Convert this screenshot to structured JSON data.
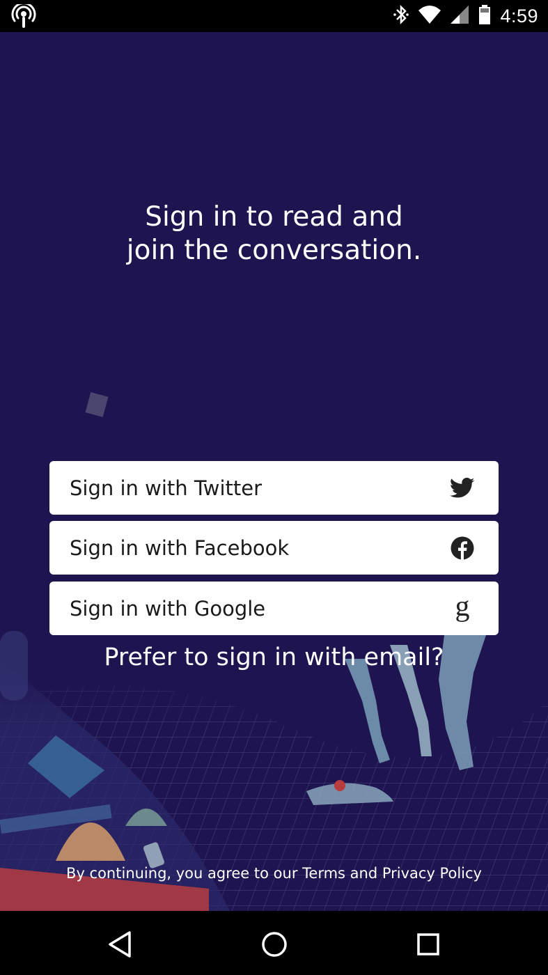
{
  "status_bar": {
    "time": "4:59",
    "icons": [
      "podcast-icon",
      "bluetooth-icon",
      "wifi-icon",
      "cell-signal-icon",
      "battery-icon"
    ]
  },
  "screen": {
    "headline": {
      "line1": "Sign in to read and",
      "line2": "join the conversation."
    },
    "buttons": [
      {
        "label": "Sign in with Twitter",
        "icon": "twitter-icon"
      },
      {
        "label": "Sign in with Facebook",
        "icon": "facebook-icon"
      },
      {
        "label": "Sign in with Google",
        "icon": "google-icon"
      }
    ],
    "email_prompt": "Prefer to sign in with email?",
    "terms": {
      "prefix": "By continuing, you agree to our ",
      "terms_link": "Terms",
      "middle": " and ",
      "privacy_link": "Privacy Policy"
    }
  },
  "nav_bar": {
    "icons": [
      "back-icon",
      "home-icon",
      "recents-icon"
    ]
  },
  "colors": {
    "background": "#1d1450",
    "button": "#ffffff",
    "text": "#ffffff"
  }
}
